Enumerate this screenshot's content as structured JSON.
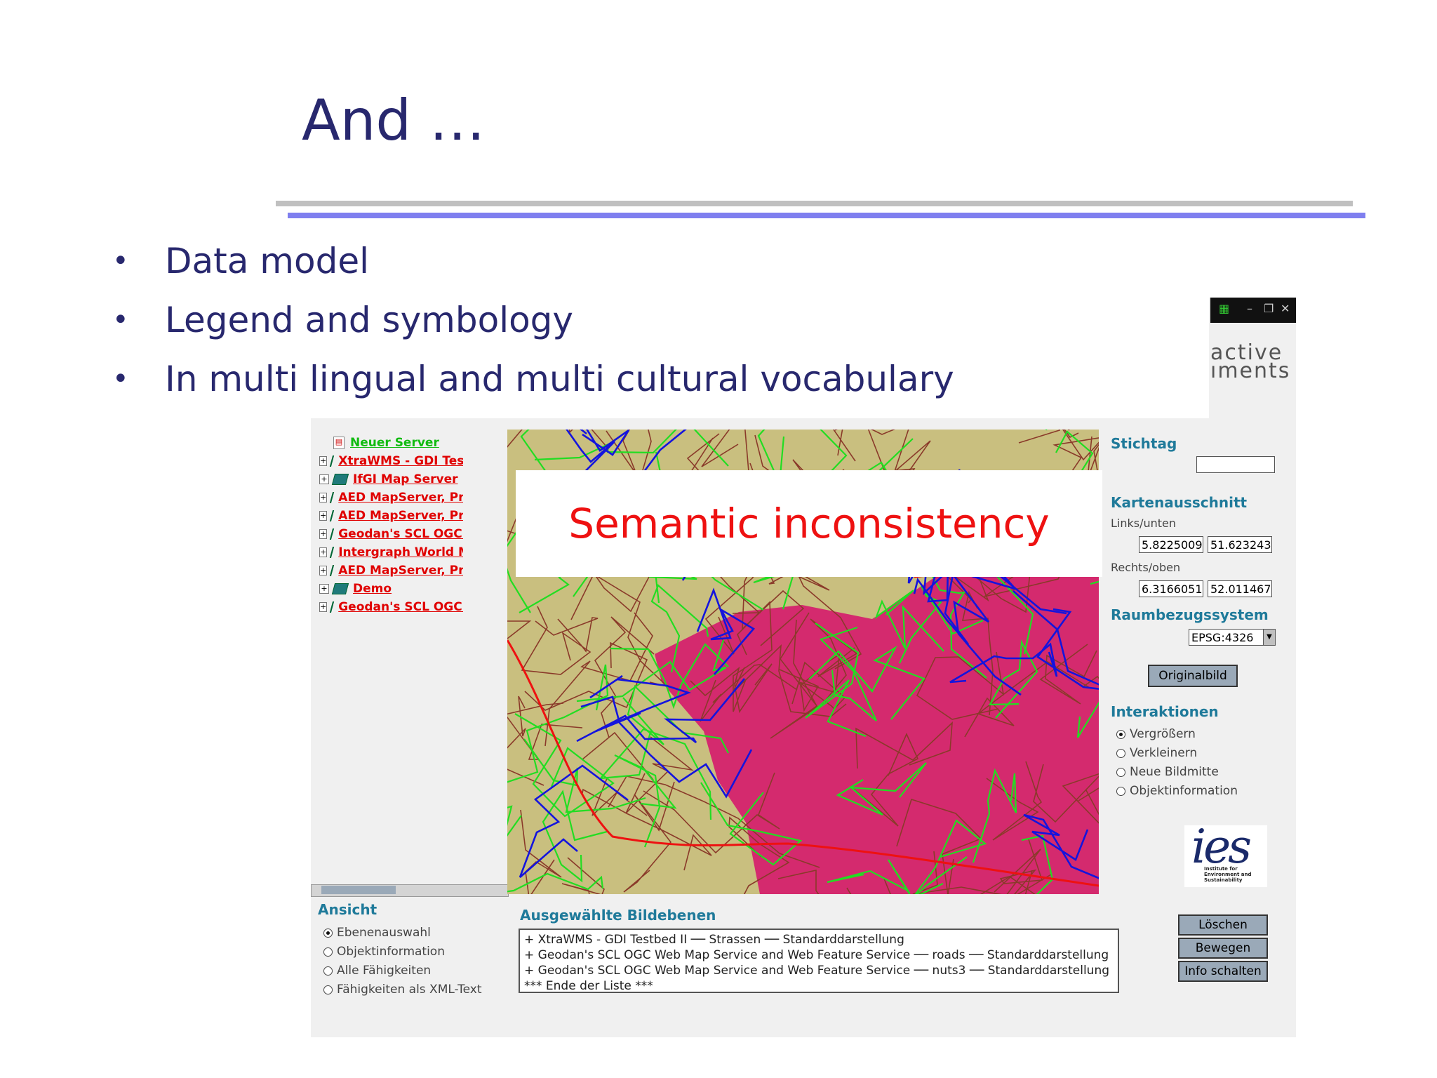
{
  "slide": {
    "title": "And …",
    "bullets": [
      "Data model",
      "Legend and symbology",
      "In multi lingual and multi cultural vocabulary"
    ],
    "bullet_char": "•"
  },
  "window": {
    "brand_line1": "active",
    "brand_line2": "ıments"
  },
  "tree": {
    "items": [
      {
        "label": "Neuer Server"
      },
      {
        "label": "XtraWMS - GDI Testbed I"
      },
      {
        "label": "IfGI Map Server"
      },
      {
        "label": "AED MapServer, Projekt"
      },
      {
        "label": "AED MapServer, Projekt"
      },
      {
        "label": "Geodan's SCL OGC Web"
      },
      {
        "label": "Intergraph World Map"
      },
      {
        "label": "AED MapServer, Projekt"
      },
      {
        "label": "Demo"
      },
      {
        "label": "Geodan's SCL OGC Web"
      }
    ]
  },
  "overlay": {
    "text": "Semantic inconsistency"
  },
  "right_panel": {
    "stichtag_heading": "Stichtag",
    "stichtag_value": "",
    "extent_heading": "Kartenausschnitt",
    "lower_left_label": "Links/unten",
    "ll_x": "5.82250095",
    "ll_y": "51.6232431",
    "upper_right_label": "Rechts/oben",
    "ur_x": "6.31660515",
    "ur_y": "52.0114678",
    "crs_heading": "Raumbezugssystem",
    "crs_value": "EPSG:4326",
    "original_button": "Originalbild",
    "interaction_heading": "Interaktionen",
    "interactions": [
      "Vergrößern",
      "Verkleinern",
      "Neue Bildmitte",
      "Objektinformation"
    ],
    "interaction_selected": 0
  },
  "logo": {
    "text": "ies",
    "subtitle_line1": "Institute for",
    "subtitle_line2": "Environment and",
    "subtitle_line3": "Sustainability"
  },
  "view_panel": {
    "heading": "Ansicht",
    "options": [
      "Ebenenauswahl",
      "Objektinformation",
      "Alle Fähigkeiten",
      "Fähigkeiten als XML-Text"
    ],
    "selected": 0
  },
  "layers": {
    "heading": "Ausgewählte Bildebenen",
    "items": [
      "+ XtraWMS - GDI Testbed II ── Strassen ── Standarddarstellung",
      "+ Geodan's SCL OGC Web Map Service and Web Feature Service ── roads ── Standarddarstellung",
      "+ Geodan's SCL OGC Web Map Service and Web Feature Service ── nuts3 ── Standarddarstellung",
      "*** Ende der Liste ***"
    ]
  },
  "actions": {
    "delete": "Löschen",
    "move": "Bewegen",
    "info": "Info schalten"
  },
  "colors": {
    "title": "#28286e",
    "map_land": "#c9bf7f",
    "map_region": "#d42a6e",
    "road_green": "#22dd22",
    "road_blue": "#1414dd",
    "road_brown": "#8a3a2a",
    "road_red": "#ee1111",
    "accent": "#1f7a9a"
  }
}
